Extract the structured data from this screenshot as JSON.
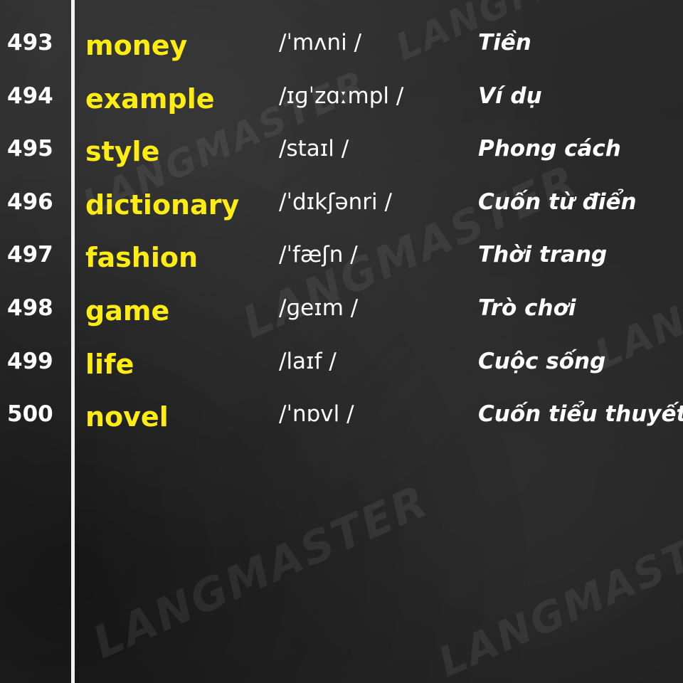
{
  "watermark": "LANGMASTER",
  "colors": {
    "background": "#262626",
    "word": "#ffec12",
    "text": "#ffffff",
    "divider": "#f2f2f2"
  },
  "entries": [
    {
      "number": "493",
      "word": "money",
      "ipa": "/ˈmʌni /",
      "meaning": "Tiền"
    },
    {
      "number": "494",
      "word": "example",
      "ipa": "/ɪɡˈzɑːmpl /",
      "meaning": "Ví dụ"
    },
    {
      "number": "495",
      "word": "style",
      "ipa": "/staɪl /",
      "meaning": "Phong cách"
    },
    {
      "number": "496",
      "word": "dictionary",
      "ipa": "/ˈdɪkʃənri /",
      "meaning": "Cuốn từ điển"
    },
    {
      "number": "497",
      "word": "fashion",
      "ipa": "/ˈfæʃn /",
      "meaning": "Thời trang"
    },
    {
      "number": "498",
      "word": "game",
      "ipa": "/ɡeɪm /",
      "meaning": "Trò chơi"
    },
    {
      "number": "499",
      "word": "life",
      "ipa": "/laɪf /",
      "meaning": "Cuộc sống"
    },
    {
      "number": "500",
      "word": "novel",
      "ipa": "/ˈnɒvl /",
      "meaning": "Cuốn tiểu thuyết"
    }
  ]
}
